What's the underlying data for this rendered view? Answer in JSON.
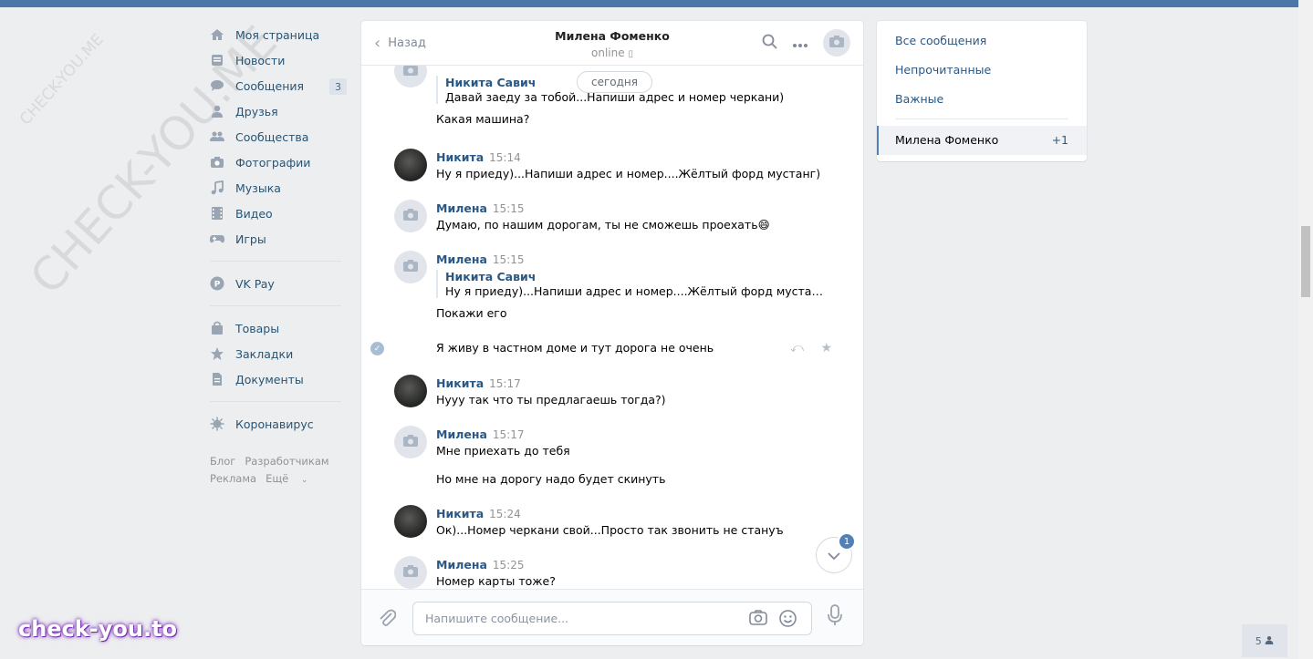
{
  "nav": {
    "items": [
      {
        "label": "Моя страница",
        "icon": "home-icon"
      },
      {
        "label": "Новости",
        "icon": "news-icon"
      },
      {
        "label": "Сообщения",
        "icon": "messages-icon",
        "badge": "3"
      },
      {
        "label": "Друзья",
        "icon": "friend-icon"
      },
      {
        "label": "Сообщества",
        "icon": "groups-icon"
      },
      {
        "label": "Фотографии",
        "icon": "camera-icon"
      },
      {
        "label": "Музыка",
        "icon": "music-icon"
      },
      {
        "label": "Видео",
        "icon": "video-icon"
      },
      {
        "label": "Игры",
        "icon": "games-icon"
      }
    ],
    "pay": {
      "label": "VK Pay",
      "icon": "vkpay-icon"
    },
    "items2": [
      {
        "label": "Товары",
        "icon": "bag-icon"
      },
      {
        "label": "Закладки",
        "icon": "star-icon"
      },
      {
        "label": "Документы",
        "icon": "document-icon"
      }
    ],
    "corona": {
      "label": "Коронавирус",
      "icon": "virus-icon"
    },
    "footer": {
      "blog": "Блог",
      "dev": "Разработчикам",
      "ads": "Реклама",
      "more": "Ещё"
    }
  },
  "chat": {
    "back": "Назад",
    "peer_name": "Милена Фоменко",
    "peer_status": "online",
    "date_pill": "сегодня",
    "messages": [
      {
        "author": "Никита Савич",
        "text": "Давай заеду за тобой...Напиши адрес и номер черкани)"
      },
      {
        "text": "Какая машина?"
      },
      {
        "author": "Никита",
        "time": "15:14",
        "text": "Ну я приеду)...Напиши адрес и номер....Жёлтый форд мустанг)"
      },
      {
        "author": "Милена",
        "time": "15:15",
        "text": "Думаю, по нашим дорогам, ты не сможешь проехать😄"
      },
      {
        "author": "Милена",
        "time": "15:15",
        "reply_author": "Никита Савич",
        "reply_text": "Ну я приеду)...Напиши адрес и номер....Жёлтый форд муста…",
        "text": "Покажи его"
      },
      {
        "text": "Я живу в частном доме и тут дорога не очень"
      },
      {
        "author": "Никита",
        "time": "15:17",
        "text": "Нууу так что ты предлагаешь тогда?)"
      },
      {
        "author": "Милена",
        "time": "15:17",
        "text": "Мне приехать до тебя"
      },
      {
        "text": "Но мне на дорогу надо будет скинуть"
      },
      {
        "author": "Никита",
        "time": "15:24",
        "text": "Ок)...Номер черкани свой...Просто так звонить не стануъ"
      },
      {
        "author": "Милена",
        "time": "15:25",
        "text": "Номер карты тоже?"
      }
    ],
    "unread_count": "1",
    "composer_placeholder": "Напишите сообщение..."
  },
  "right_panel": {
    "all": "Все сообщения",
    "unread": "Непрочитанные",
    "important": "Важные",
    "active_name": "Милена Фоменко",
    "active_count": "+1"
  },
  "watermarks": {
    "diag_big": "CHECK-YOU.ME",
    "diag_small": "CHECK-YOU.ME",
    "brand": "check-you.to"
  },
  "online_count": "5"
}
